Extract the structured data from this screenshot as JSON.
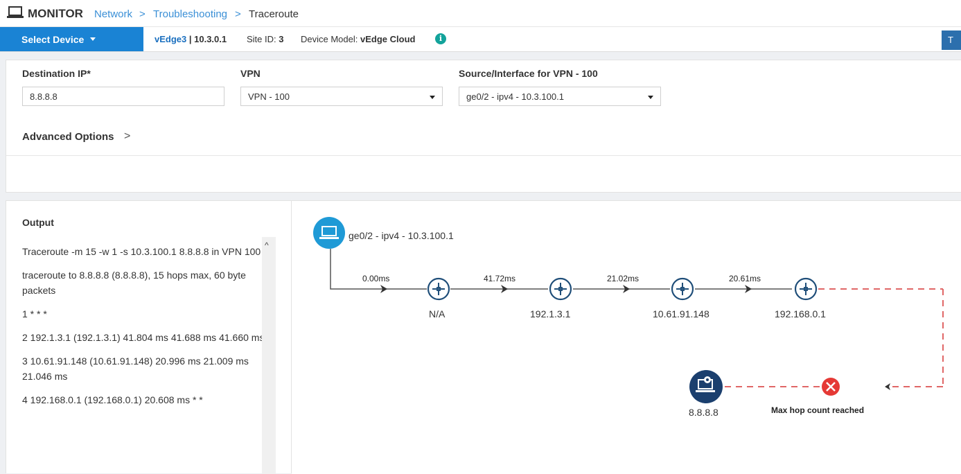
{
  "header": {
    "title": "MONITOR",
    "breadcrumb": [
      "Network",
      "Troubleshooting",
      "Traceroute"
    ],
    "separator": ">"
  },
  "device_bar": {
    "select_device_label": "Select Device",
    "device_name": "vEdge3",
    "device_ip": "| 10.3.0.1",
    "site_id_label": "Site ID:",
    "site_id_value": "3",
    "model_label": "Device Model:",
    "model_value": "vEdge Cloud",
    "info_glyph": "i",
    "right_button_label": "T"
  },
  "form": {
    "destination_ip_label": "Destination IP*",
    "destination_ip_value": "8.8.8.8",
    "vpn_label": "VPN",
    "vpn_value": "VPN - 100",
    "source_label": "Source/Interface for VPN - 100",
    "source_value": "ge0/2 - ipv4 - 10.3.100.1",
    "advanced_options_label": "Advanced Options",
    "advanced_chevron": ">"
  },
  "output": {
    "title": "Output",
    "lines": [
      "Traceroute -m 15 -w 1 -s 10.3.100.1 8.8.8.8 in VPN 100",
      "traceroute to 8.8.8.8 (8.8.8.8), 15 hops max, 60 byte packets",
      "1 * * *",
      "2 192.1.3.1 (192.1.3.1) 41.804 ms 41.688 ms 41.660 ms",
      "3 10.61.91.148 (10.61.91.148) 20.996 ms 21.009 ms 21.046 ms",
      "4 192.168.0.1 (192.168.0.1) 20.608 ms * *"
    ],
    "scroll_up_glyph": "^"
  },
  "graph": {
    "source_label": "ge0/2 - ipv4 - 10.3.100.1",
    "hops": [
      {
        "latency": "0.00ms",
        "label": "N/A"
      },
      {
        "latency": "41.72ms",
        "label": "192.1.3.1"
      },
      {
        "latency": "21.02ms",
        "label": "10.61.91.148"
      },
      {
        "latency": "20.61ms",
        "label": "192.168.0.1"
      }
    ],
    "destination_label": "8.8.8.8",
    "error_label": "Max hop count reached",
    "colors": {
      "source_node": "#1f9ad6",
      "router_icon": "#1f4e79",
      "destination_node": "#1b3f6e",
      "error": "#e53935",
      "dashed_path": "#e06666"
    }
  }
}
